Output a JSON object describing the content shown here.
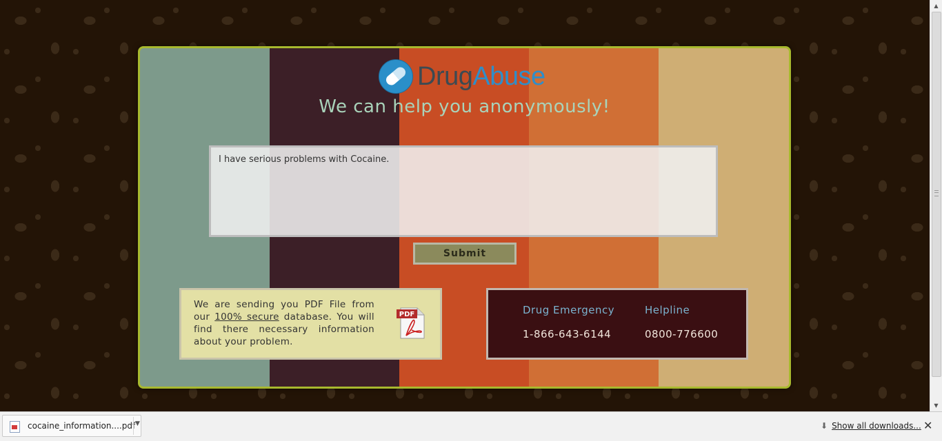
{
  "logo": {
    "part1": "Drug",
    "part2": "Abuse",
    "icon": "pill-icon",
    "color_primary": "#2f8ec9",
    "color_secondary": "#3c4a52"
  },
  "tagline": "We can help you anonymously!",
  "form": {
    "message_value": "I have serious problems with Cocaine.",
    "submit_label": "Submit"
  },
  "pdf_notice": {
    "text_before": "We are sending you PDF File from our ",
    "link_text": "100% secure",
    "text_after": " database. You will find there necessary information about your problem.",
    "icon": "pdf-icon",
    "icon_label": "PDF"
  },
  "emergency": {
    "drug_label": "Drug Emergency",
    "drug_number": "1-866-643-6144",
    "helpline_label": "Helpline",
    "helpline_number": "0800-776600"
  },
  "downloads_bar": {
    "file_name": "cocaine_information....pdf",
    "show_all_label": "Show all downloads...",
    "close_icon": "close-icon"
  },
  "colors": {
    "stripes": [
      "#7d9a8b",
      "#3c1f27",
      "#c84d24",
      "#d06f35",
      "#cfae74"
    ],
    "panel_border": "#a8b92e",
    "tagline": "#a9d3ba"
  }
}
